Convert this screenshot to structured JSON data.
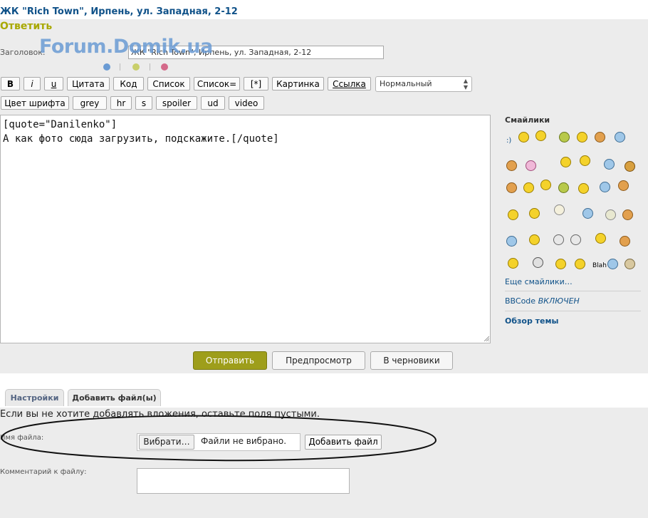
{
  "topic": {
    "title": "ЖК \"Rich Town\", Ирпень, ул. Западная, 2-12",
    "reply_label": "Ответить"
  },
  "watermark": "Forum.Domik.ua",
  "subject": {
    "label": "Заголовок:",
    "value": "ЖК \"Rich Town\", Ирпень, ул. Западная, 2-12"
  },
  "toolbar": {
    "row1": [
      "B",
      "i",
      "u",
      "Цитата",
      "Код",
      "Список",
      "Список=",
      "[*]",
      "Картинка",
      "Ссылка"
    ],
    "row2": [
      "Цвет шрифта",
      "grey",
      "hr",
      "s",
      "spoiler",
      "ud",
      "video"
    ],
    "font_size": "Нормальный"
  },
  "editor": {
    "lines": [
      "[quote=\"Danilenko\"]",
      "А как фото сюда загрузить, подскажите.[/quote]"
    ]
  },
  "colors": {
    "accent": "#9e9e1b",
    "link": "#105289",
    "dot1": "#6a9bd4",
    "dot2": "#c9cf6a",
    "dot3": "#d46a8a"
  },
  "sidebar": {
    "smilies_title": "Смайлики",
    "smilies_text": ":)",
    "blah_label": "Blah",
    "more_smilies": "Еще смайлики…",
    "bbcode_label": "BBCode",
    "bbcode_state": "ВКЛЮЧЕН",
    "topic_review": "Обзор темы"
  },
  "buttons": {
    "submit": "Отправить",
    "preview": "Предпросмотр",
    "drafts": "В черновики"
  },
  "tabs": [
    "Настройки",
    "Добавить файл(ы)"
  ],
  "attach": {
    "info": "Если вы не хотите добавлять вложения, оставьте поля пустыми.",
    "file_label": "Имя файла:",
    "choose_btn": "Вибрати…",
    "file_status": "Файли не вибрано.",
    "add_file_btn": "Добавить файл",
    "comment_label": "Комментарий к файлу:"
  }
}
